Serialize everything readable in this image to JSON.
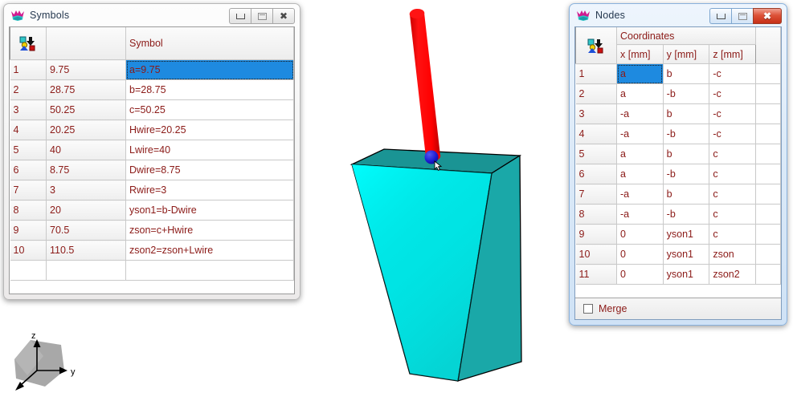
{
  "symbols_window": {
    "title": "Symbols",
    "app_icon": "w-crown-icon",
    "controls": {
      "minimize": "–",
      "maximize": "□",
      "close": "✕"
    },
    "table": {
      "corner_icon": "select-objects-icon",
      "headers": [
        "",
        "",
        "Symbol"
      ],
      "symbol_header": "Symbol",
      "rows": [
        {
          "n": "1",
          "value": "9.75",
          "expr": "a=9.75",
          "selected": true
        },
        {
          "n": "2",
          "value": "28.75",
          "expr": "b=28.75",
          "selected": false
        },
        {
          "n": "3",
          "value": "50.25",
          "expr": "c=50.25",
          "selected": false
        },
        {
          "n": "4",
          "value": "20.25",
          "expr": "Hwire=20.25",
          "selected": false
        },
        {
          "n": "5",
          "value": "40",
          "expr": "Lwire=40",
          "selected": false
        },
        {
          "n": "6",
          "value": "8.75",
          "expr": "Dwire=8.75",
          "selected": false
        },
        {
          "n": "7",
          "value": "3",
          "expr": "Rwire=3",
          "selected": false
        },
        {
          "n": "8",
          "value": "20",
          "expr": "yson1=b-Dwire",
          "selected": false
        },
        {
          "n": "9",
          "value": "70.5",
          "expr": "zson=c+Hwire",
          "selected": false
        },
        {
          "n": "10",
          "value": "110.5",
          "expr": "zson2=zson+Lwire",
          "selected": false
        }
      ]
    }
  },
  "nodes_window": {
    "title": "Nodes",
    "app_icon": "w-crown-icon",
    "active": true,
    "controls": {
      "minimize": "–",
      "maximize": "□",
      "close": "✕"
    },
    "table": {
      "corner_icon": "select-objects-icon",
      "group_header": "Coordinates",
      "columns": [
        "x [mm]",
        "y [mm]",
        "z [mm]"
      ],
      "rows": [
        {
          "n": "1",
          "x": "a",
          "y": "b",
          "z": "-c",
          "x_selected": true
        },
        {
          "n": "2",
          "x": "a",
          "y": "-b",
          "z": "-c",
          "x_selected": false
        },
        {
          "n": "3",
          "x": "-a",
          "y": "b",
          "z": "-c",
          "x_selected": false
        },
        {
          "n": "4",
          "x": "-a",
          "y": "-b",
          "z": "-c",
          "x_selected": false
        },
        {
          "n": "5",
          "x": "a",
          "y": "b",
          "z": "c",
          "x_selected": false
        },
        {
          "n": "6",
          "x": "a",
          "y": "-b",
          "z": "c",
          "x_selected": false
        },
        {
          "n": "7",
          "x": "-a",
          "y": "b",
          "z": "c",
          "x_selected": false
        },
        {
          "n": "8",
          "x": "-a",
          "y": "-b",
          "z": "c",
          "x_selected": false
        },
        {
          "n": "9",
          "x": "0",
          "y": "yson1",
          "z": "c",
          "x_selected": false
        },
        {
          "n": "10",
          "x": "0",
          "y": "yson1",
          "z": "zson",
          "x_selected": false
        },
        {
          "n": "11",
          "x": "0",
          "y": "yson1",
          "z": "zson2",
          "x_selected": false
        }
      ]
    },
    "merge": {
      "label": "Merge",
      "checked": false
    }
  },
  "viewport": {
    "box_color_front": "#00e5e5",
    "box_color_side": "#1aa8a8",
    "box_color_top": "#1a9494",
    "wire_color": "#ff0000",
    "node_color": "#1a1ad0",
    "edge_color": "#000000"
  },
  "axis_gizmo": {
    "labels": {
      "z": "z",
      "y": "y",
      "x": ""
    },
    "cube_color": "#a8a8a8"
  },
  "colors": {
    "grid_text": "#8b1a17",
    "selection": "#1e8ae0",
    "title_text": "#25384f"
  }
}
